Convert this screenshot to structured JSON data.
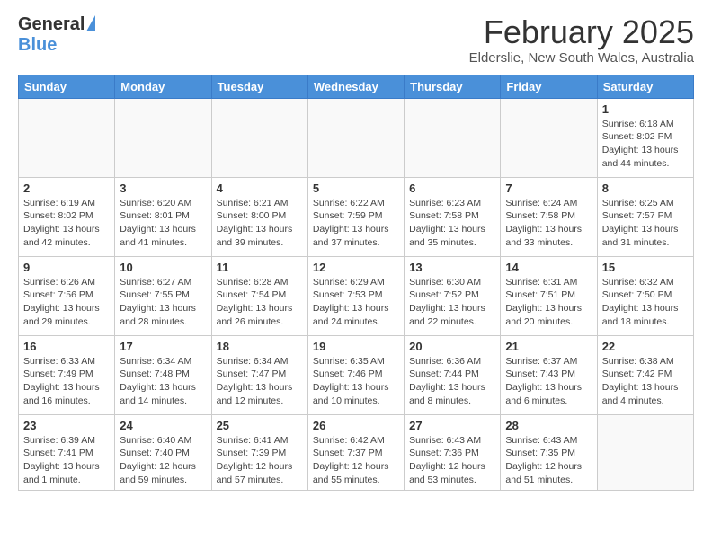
{
  "logo": {
    "general": "General",
    "blue": "Blue"
  },
  "header": {
    "month": "February 2025",
    "location": "Elderslie, New South Wales, Australia"
  },
  "weekdays": [
    "Sunday",
    "Monday",
    "Tuesday",
    "Wednesday",
    "Thursday",
    "Friday",
    "Saturday"
  ],
  "weeks": [
    [
      {
        "day": "",
        "info": ""
      },
      {
        "day": "",
        "info": ""
      },
      {
        "day": "",
        "info": ""
      },
      {
        "day": "",
        "info": ""
      },
      {
        "day": "",
        "info": ""
      },
      {
        "day": "",
        "info": ""
      },
      {
        "day": "1",
        "info": "Sunrise: 6:18 AM\nSunset: 8:02 PM\nDaylight: 13 hours\nand 44 minutes."
      }
    ],
    [
      {
        "day": "2",
        "info": "Sunrise: 6:19 AM\nSunset: 8:02 PM\nDaylight: 13 hours\nand 42 minutes."
      },
      {
        "day": "3",
        "info": "Sunrise: 6:20 AM\nSunset: 8:01 PM\nDaylight: 13 hours\nand 41 minutes."
      },
      {
        "day": "4",
        "info": "Sunrise: 6:21 AM\nSunset: 8:00 PM\nDaylight: 13 hours\nand 39 minutes."
      },
      {
        "day": "5",
        "info": "Sunrise: 6:22 AM\nSunset: 7:59 PM\nDaylight: 13 hours\nand 37 minutes."
      },
      {
        "day": "6",
        "info": "Sunrise: 6:23 AM\nSunset: 7:58 PM\nDaylight: 13 hours\nand 35 minutes."
      },
      {
        "day": "7",
        "info": "Sunrise: 6:24 AM\nSunset: 7:58 PM\nDaylight: 13 hours\nand 33 minutes."
      },
      {
        "day": "8",
        "info": "Sunrise: 6:25 AM\nSunset: 7:57 PM\nDaylight: 13 hours\nand 31 minutes."
      }
    ],
    [
      {
        "day": "9",
        "info": "Sunrise: 6:26 AM\nSunset: 7:56 PM\nDaylight: 13 hours\nand 29 minutes."
      },
      {
        "day": "10",
        "info": "Sunrise: 6:27 AM\nSunset: 7:55 PM\nDaylight: 13 hours\nand 28 minutes."
      },
      {
        "day": "11",
        "info": "Sunrise: 6:28 AM\nSunset: 7:54 PM\nDaylight: 13 hours\nand 26 minutes."
      },
      {
        "day": "12",
        "info": "Sunrise: 6:29 AM\nSunset: 7:53 PM\nDaylight: 13 hours\nand 24 minutes."
      },
      {
        "day": "13",
        "info": "Sunrise: 6:30 AM\nSunset: 7:52 PM\nDaylight: 13 hours\nand 22 minutes."
      },
      {
        "day": "14",
        "info": "Sunrise: 6:31 AM\nSunset: 7:51 PM\nDaylight: 13 hours\nand 20 minutes."
      },
      {
        "day": "15",
        "info": "Sunrise: 6:32 AM\nSunset: 7:50 PM\nDaylight: 13 hours\nand 18 minutes."
      }
    ],
    [
      {
        "day": "16",
        "info": "Sunrise: 6:33 AM\nSunset: 7:49 PM\nDaylight: 13 hours\nand 16 minutes."
      },
      {
        "day": "17",
        "info": "Sunrise: 6:34 AM\nSunset: 7:48 PM\nDaylight: 13 hours\nand 14 minutes."
      },
      {
        "day": "18",
        "info": "Sunrise: 6:34 AM\nSunset: 7:47 PM\nDaylight: 13 hours\nand 12 minutes."
      },
      {
        "day": "19",
        "info": "Sunrise: 6:35 AM\nSunset: 7:46 PM\nDaylight: 13 hours\nand 10 minutes."
      },
      {
        "day": "20",
        "info": "Sunrise: 6:36 AM\nSunset: 7:44 PM\nDaylight: 13 hours\nand 8 minutes."
      },
      {
        "day": "21",
        "info": "Sunrise: 6:37 AM\nSunset: 7:43 PM\nDaylight: 13 hours\nand 6 minutes."
      },
      {
        "day": "22",
        "info": "Sunrise: 6:38 AM\nSunset: 7:42 PM\nDaylight: 13 hours\nand 4 minutes."
      }
    ],
    [
      {
        "day": "23",
        "info": "Sunrise: 6:39 AM\nSunset: 7:41 PM\nDaylight: 13 hours\nand 1 minute."
      },
      {
        "day": "24",
        "info": "Sunrise: 6:40 AM\nSunset: 7:40 PM\nDaylight: 12 hours\nand 59 minutes."
      },
      {
        "day": "25",
        "info": "Sunrise: 6:41 AM\nSunset: 7:39 PM\nDaylight: 12 hours\nand 57 minutes."
      },
      {
        "day": "26",
        "info": "Sunrise: 6:42 AM\nSunset: 7:37 PM\nDaylight: 12 hours\nand 55 minutes."
      },
      {
        "day": "27",
        "info": "Sunrise: 6:43 AM\nSunset: 7:36 PM\nDaylight: 12 hours\nand 53 minutes."
      },
      {
        "day": "28",
        "info": "Sunrise: 6:43 AM\nSunset: 7:35 PM\nDaylight: 12 hours\nand 51 minutes."
      },
      {
        "day": "",
        "info": ""
      }
    ]
  ]
}
